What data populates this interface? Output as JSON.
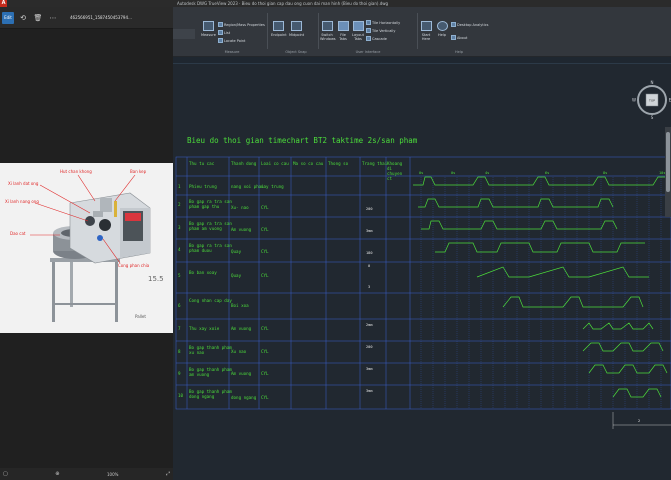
{
  "app": {
    "logo": "A",
    "title": "Autodesk DWG TrueView 2023 · Bieu do thoi gian cap dau ong cuon dai man hinh (Bieu do thoi gian).dwg"
  },
  "viewer": {
    "filename": "462566951_1587450453794…",
    "zoom": "100%",
    "tool_active": "Edit",
    "photo_labels": {
      "a": "Hut chan khong",
      "b": "Xi lanh dat ong",
      "c": "Ban kep",
      "d": "Xi lanh nang ong",
      "e": "Dao cat",
      "f": "Cong phan chia",
      "g": "15.5",
      "h": "Pallet"
    }
  },
  "ribbon": {
    "groups": {
      "measure": "Measure",
      "object_snap": "Object Snap",
      "user_interface": "User Interface",
      "help": "Help"
    },
    "items": {
      "measure_btn": "Measure",
      "region_mass": "Region/Mass Properties",
      "list": "List",
      "locate_point": "Locate Point",
      "endpoint": "Endpoint",
      "midpoint": "Midpoint",
      "switch_windows": "Switch Windows",
      "file_tabs": "File Tabs",
      "layout_tabs": "Layout Tabs",
      "tile_horizontally": "Tile Horizontally",
      "tile_vertically": "Tile Vertically",
      "cascade": "Cascade",
      "start_here": "Start Here",
      "help_btn": "Help",
      "desktop_analytics": "Desktop Analytics",
      "about": "About"
    }
  },
  "compass": {
    "n": "N",
    "s": "S",
    "e": "E",
    "w": "W",
    "top": "TOP"
  },
  "drawing": {
    "title": "Bieu do thoi gian timechart BT2 taktime 2s/san pham",
    "headers": [
      "Thu tu cac",
      "Thanh dong",
      "Loai co cau",
      "Ma so co cau",
      "Thong so",
      "Trang thai",
      "Khoang di chuyen ct"
    ],
    "rows": [
      {
        "no": "1",
        "step": "Phieu trung",
        "act": "nang xoi phai",
        "dev": "",
        "note": "nay trung"
      },
      {
        "no": "2",
        "step": "Bo gap ra tra san pham gap thu",
        "act": "",
        "dev": "Xu- nao",
        "note": "CYL"
      },
      {
        "no": "3",
        "step": "Bo gap ra tra san pham am vuong",
        "act": "",
        "dev": "Am vuong",
        "note": "CYL"
      },
      {
        "no": "4",
        "step": "Bo gap ra tra san pham duou",
        "act": "",
        "dev": "Quay",
        "note": "CYL"
      },
      {
        "no": "5",
        "step": "Bo ban xoay",
        "act": "",
        "dev": "Quay",
        "note": "CYL"
      },
      {
        "no": "6",
        "step": "Cong nhan cap day",
        "act": "",
        "dev": "Boi xoa",
        "note": ""
      },
      {
        "no": "7",
        "step": "Thu xay xoie",
        "act": "",
        "dev": "Am vuong",
        "note": "CYL"
      },
      {
        "no": "8",
        "step": "Bo gap thanh pham xu nao",
        "act": "",
        "dev": "Xu nao",
        "note": "CYL"
      },
      {
        "no": "9",
        "step": "Bo gap thanh pham am vuong",
        "act": "",
        "dev": "Am vuong",
        "note": "CYL"
      },
      {
        "no": "10",
        "step": "Bo gap thanh pham dong ngang",
        "act": "",
        "dev": "dong ngang",
        "note": "CYL"
      }
    ],
    "white_vals": [
      "200",
      "30s",
      "3mm",
      "30s",
      "180",
      "3s",
      "0",
      "3",
      "2mm",
      "5s",
      "200",
      "30s",
      "3mm",
      "20s",
      "3mm",
      "20s"
    ],
    "time_labels": [
      "0s",
      "0s",
      "4s",
      "6s",
      "8s",
      "10s"
    ],
    "dim_label": "2"
  }
}
